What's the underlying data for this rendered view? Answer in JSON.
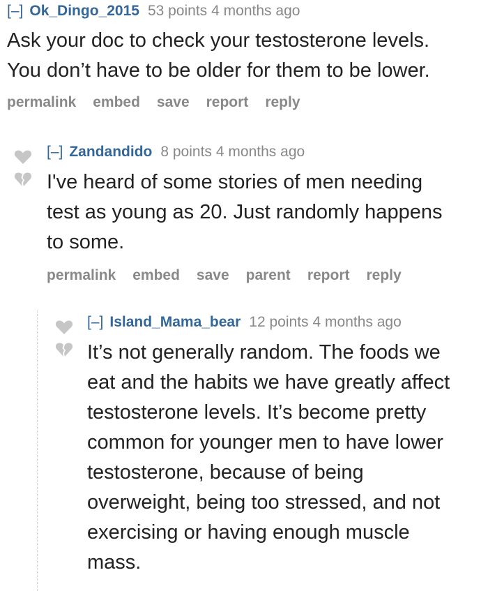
{
  "comments": [
    {
      "toggle": "[–]",
      "author": "Ok_Dingo_2015",
      "score": "53 points",
      "time": "4 months ago",
      "body": [
        "Ask your doc to check your testosterone levels.",
        "You don’t have to be older for them to be lower."
      ],
      "buttons": [
        "permalink",
        "embed",
        "save",
        "report",
        "reply"
      ]
    },
    {
      "toggle": "[–]",
      "author": "Zandandido",
      "score": "8 points",
      "time": "4 months ago",
      "body": [
        "I've heard of some stories of men needing",
        "test as young as 20. Just randomly happens",
        "to some."
      ],
      "buttons": [
        "permalink",
        "embed",
        "save",
        "parent",
        "report",
        "reply"
      ]
    },
    {
      "toggle": "[–]",
      "author": "Island_Mama_bear",
      "score": "12 points",
      "time": "4 months ago",
      "body": [
        "It’s not generally random. The foods we",
        "eat and the habits we have greatly affect",
        "testosterone levels. It’s become pretty",
        "common for younger men to have lower",
        "testosterone, because of being",
        "overweight, being too stressed, and not",
        "exercising or having enough muscle",
        "mass."
      ]
    }
  ],
  "icons": {
    "upvote": "heart-upvote-icon",
    "downvote": "broken-heart-downvote-icon",
    "vote_color": "#c6c6c6"
  }
}
